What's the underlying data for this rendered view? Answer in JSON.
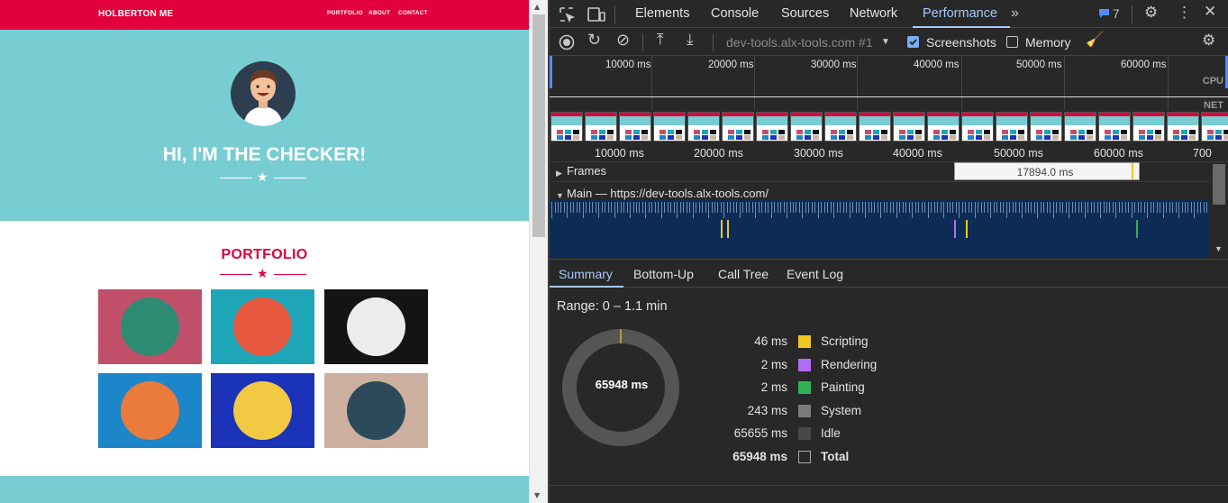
{
  "site": {
    "brand": "HOLBERTON ME",
    "nav": [
      "PORTFOLIO",
      "ABOUT",
      "CONTACT"
    ],
    "hero_title": "HI, I'M THE CHECKER!",
    "portfolio_title": "PORTFOLIO",
    "tiles": [
      {
        "icon": "cabin-icon",
        "bg": "#c0506a",
        "disc": "#2e8c73"
      },
      {
        "icon": "cake-slice-icon",
        "bg": "#1ea6b8",
        "disc": "#e5573f"
      },
      {
        "icon": "circus-tent-icon",
        "bg": "#141414",
        "disc": "#ececec"
      },
      {
        "icon": "gamepad-icon",
        "bg": "#1d86c8",
        "disc": "#ea7b3c"
      },
      {
        "icon": "safe-icon",
        "bg": "#1a33b8",
        "disc": "#f1c943"
      },
      {
        "icon": "submarine-icon",
        "bg": "#cdb0a0",
        "disc": "#2c4a5a"
      }
    ],
    "colors": {
      "brand": "#e1003b",
      "hero": "#78cdd2"
    }
  },
  "devtools": {
    "tabs": [
      "Elements",
      "Console",
      "Sources",
      "Network",
      "Performance"
    ],
    "active_tab": "Performance",
    "issues_count": "7",
    "toolbar": {
      "target": "dev-tools.alx-tools.com #1",
      "screenshots_label": "Screenshots",
      "screenshots_checked": true,
      "memory_label": "Memory",
      "memory_checked": false
    },
    "overview_ticks": [
      "10000 ms",
      "20000 ms",
      "30000 ms",
      "40000 ms",
      "50000 ms",
      "60000 ms"
    ],
    "overview_labels": {
      "cpu": "CPU",
      "net": "NET"
    },
    "ruler_ticks": [
      "10000 ms",
      "20000 ms",
      "30000 ms",
      "40000 ms",
      "50000 ms",
      "60000 ms",
      "700"
    ],
    "frames_label": "Frames",
    "frame_duration": "17894.0 ms",
    "main_label": "Main — https://dev-tools.alx-tools.com/",
    "bottom_tabs": [
      "Summary",
      "Bottom-Up",
      "Call Tree",
      "Event Log"
    ],
    "active_bottom_tab": "Summary",
    "range": "Range: 0 – 1.1 min",
    "total_center": "65948 ms",
    "summary": [
      {
        "value": "46 ms",
        "label": "Scripting",
        "color": "#f2c623"
      },
      {
        "value": "2 ms",
        "label": "Rendering",
        "color": "#b16cf3"
      },
      {
        "value": "2 ms",
        "label": "Painting",
        "color": "#2fb157"
      },
      {
        "value": "243 ms",
        "label": "System",
        "color": "#7c7c7c"
      },
      {
        "value": "65655 ms",
        "label": "Idle",
        "color": "#474747"
      },
      {
        "value": "65948 ms",
        "label": "Total",
        "color": "#282828"
      }
    ]
  }
}
